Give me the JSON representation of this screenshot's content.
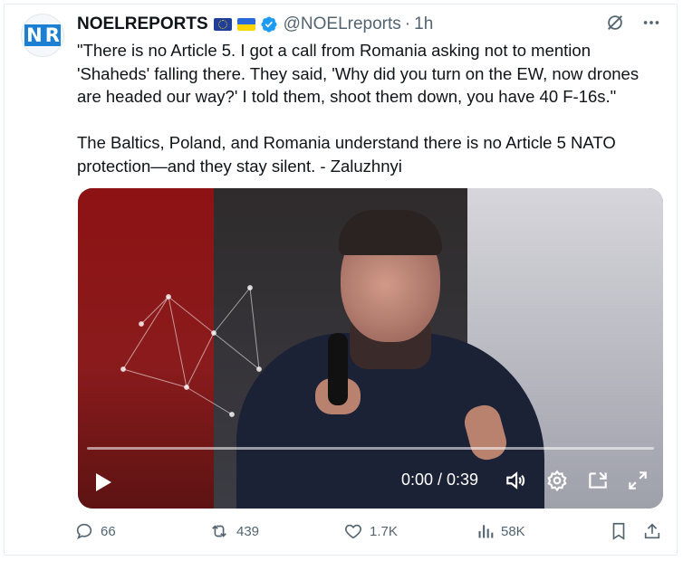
{
  "account": {
    "display_name": "NOELREPORTS",
    "handle": "@NOELreports",
    "separator": "·",
    "timestamp": "1h",
    "avatar_text_a": "N",
    "avatar_text_b": "R"
  },
  "tweet": {
    "text": "\"There is no Article 5. I got a call from Romania asking not to mention 'Shaheds' falling there. They said, 'Why did you turn on the EW, now drones are headed our way?' I told them, shoot them down, you have 40 F-16s.\"\n\nThe Baltics, Poland, and Romania understand there is no Article 5 NATO protection—and they stay silent. - Zaluzhnyi"
  },
  "video": {
    "timecode": "0:00 / 0:39",
    "progress": 0
  },
  "actions": {
    "replies": "66",
    "reposts": "439",
    "likes": "1.7K",
    "views": "58K"
  },
  "icons": {
    "verified": "verified-badge-icon",
    "grok": "grok-icon",
    "more": "more-icon",
    "play": "play-icon",
    "volume": "volume-icon",
    "settings": "settings-icon",
    "pip": "picture-in-picture-icon",
    "fullscreen": "fullscreen-icon",
    "reply": "reply-icon",
    "repost": "repost-icon",
    "like": "like-icon",
    "views": "views-icon",
    "bookmark": "bookmark-icon",
    "share": "share-icon"
  },
  "colors": {
    "text": "#0f1419",
    "secondary": "#536471",
    "verified": "#1d9bf0"
  }
}
